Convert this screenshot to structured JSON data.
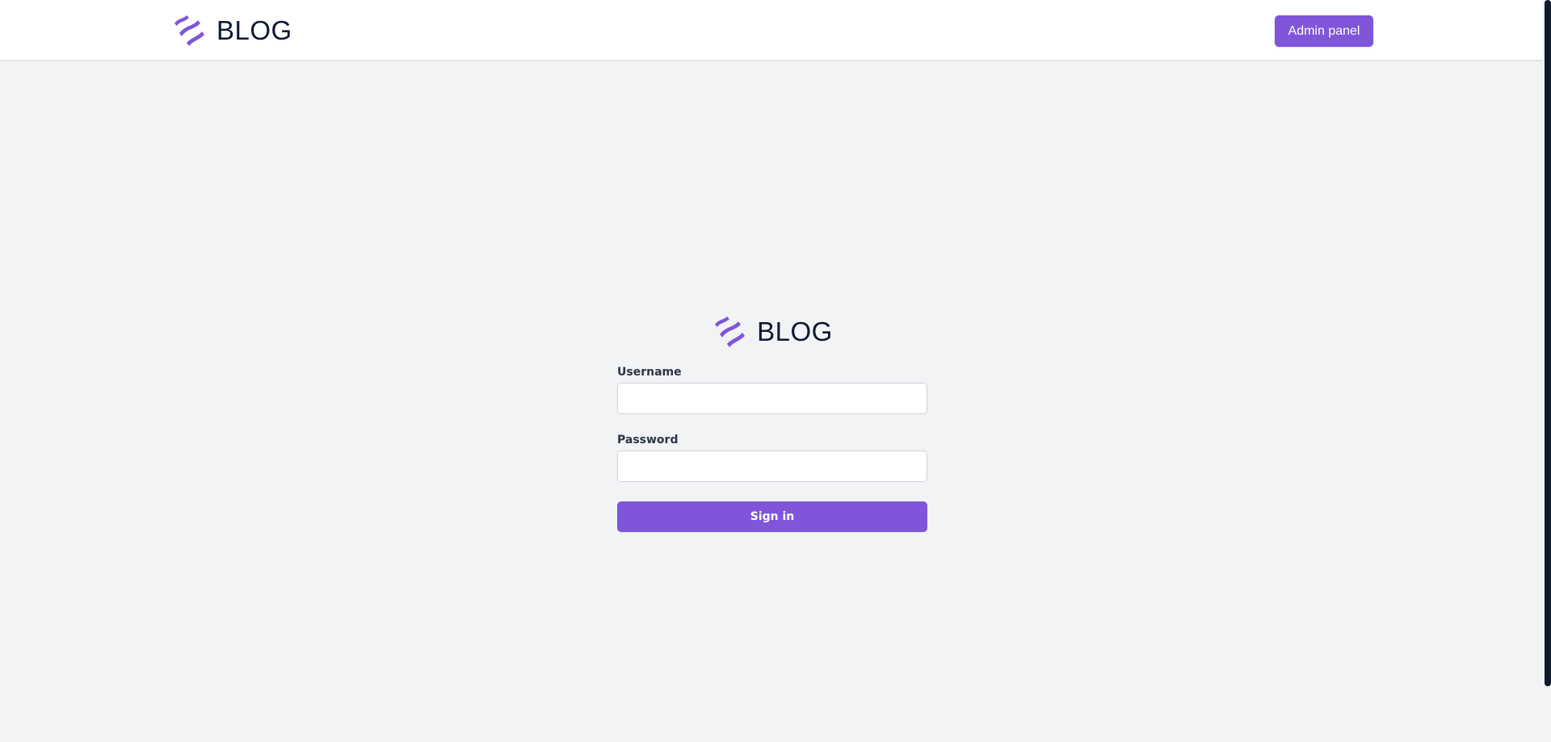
{
  "brand": {
    "name": "BLOG",
    "logo_icon": "wave-stripes-logo",
    "logo_color": "#7f56d9"
  },
  "header": {
    "admin_button_label": "Admin panel"
  },
  "login": {
    "username_label": "Username",
    "username_value": "",
    "password_label": "Password",
    "password_value": "",
    "submit_label": "Sign in"
  },
  "colors": {
    "accent": "#7f56d9",
    "background": "#f2f3f5",
    "text_dark": "#0f1733"
  }
}
